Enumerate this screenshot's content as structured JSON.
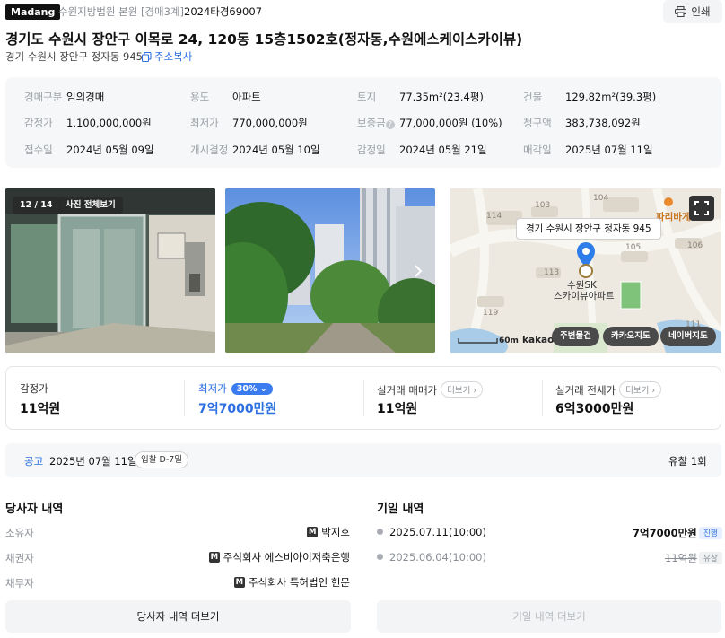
{
  "header": {
    "logo": "Madang",
    "court": "수원지방법원 본원 [경매3계]",
    "case_no": "2024타경69007",
    "print_label": "인쇄",
    "title": "경기도 수원시 장안구 이목로 24, 120동 15층1502호(정자동,수원에스케이스카이뷰)",
    "sub_address": "경기 수원시 장안구 정자동 945",
    "copy_label": "주소복사"
  },
  "info": {
    "rows": [
      [
        {
          "label": "경매구분",
          "value": "임의경매"
        },
        {
          "label": "용도",
          "value": "아파트"
        },
        {
          "label": "토지",
          "value": "77.35m²(23.4평)"
        },
        {
          "label": "건물",
          "value": "129.82m²(39.3평)"
        }
      ],
      [
        {
          "label": "감정가",
          "value": "1,100,000,000원"
        },
        {
          "label": "최저가",
          "value": "770,000,000원"
        },
        {
          "label": "보증금",
          "value": "77,000,000원 (10%)"
        },
        {
          "label": "청구액",
          "value": "383,738,092원"
        }
      ],
      [
        {
          "label": "접수일",
          "value": "2024년 05월 09일"
        },
        {
          "label": "개시결정",
          "value": "2024년 05월 10일"
        },
        {
          "label": "감정일",
          "value": "2024년 05월 21일"
        },
        {
          "label": "매각일",
          "value": "2025년 07월 11일"
        }
      ]
    ]
  },
  "photos": {
    "counter": "12 / 14",
    "view_all": "사진 전체보기"
  },
  "map": {
    "address_bubble": "경기 수원시 장안구 정자동 945",
    "place_name_1": "수원SK",
    "place_name_2": "스카이뷰아파트",
    "poi": "파리바게",
    "building_numbers": [
      "104",
      "103",
      "114",
      "105",
      "106",
      "113",
      "119",
      "111"
    ],
    "scale": "60m",
    "brand": "kakao",
    "buttons": [
      "주변물건",
      "카카오지도",
      "네이버지도"
    ]
  },
  "prices": {
    "appraisal_label": "감정가",
    "appraisal_value": "11억원",
    "minimum_label": "최저가",
    "minimum_pct": "30%",
    "minimum_value": "7억7000만원",
    "trade_label": "실거래 매매가",
    "trade_value": "11억원",
    "lease_label": "실거래 전세가",
    "lease_value": "6억3000만원",
    "more_label": "더보기"
  },
  "notice": {
    "label": "공고",
    "date": "2025년 07월 11일",
    "dday": "입찰 D-7일",
    "result": "유찰 1회"
  },
  "parties": {
    "title": "당사자 내역",
    "rows": [
      {
        "label": "소유자",
        "badge": "M",
        "value": "박지호"
      },
      {
        "label": "채권자",
        "badge": "M",
        "value": "주식회사 에스비아이저축은행"
      },
      {
        "label": "채무자",
        "badge": "M",
        "value": "주식회사 특허법인 헌문"
      }
    ],
    "more_button": "당사자 내역 더보기"
  },
  "schedule": {
    "title": "기일 내역",
    "rows": [
      {
        "date": "2025.07.11(10:00)",
        "price": "7억7000만원",
        "status": "진행"
      },
      {
        "date": "2025.06.04(10:00)",
        "price": "11억원",
        "status": "유찰"
      }
    ],
    "more_button": "기일 내역 더보기"
  },
  "colors": {
    "accent": "#2b6fe0",
    "pin": "#2f7de9",
    "progress_tag_bg": "#e6efff",
    "fail_tag_bg": "#eef0f2"
  }
}
